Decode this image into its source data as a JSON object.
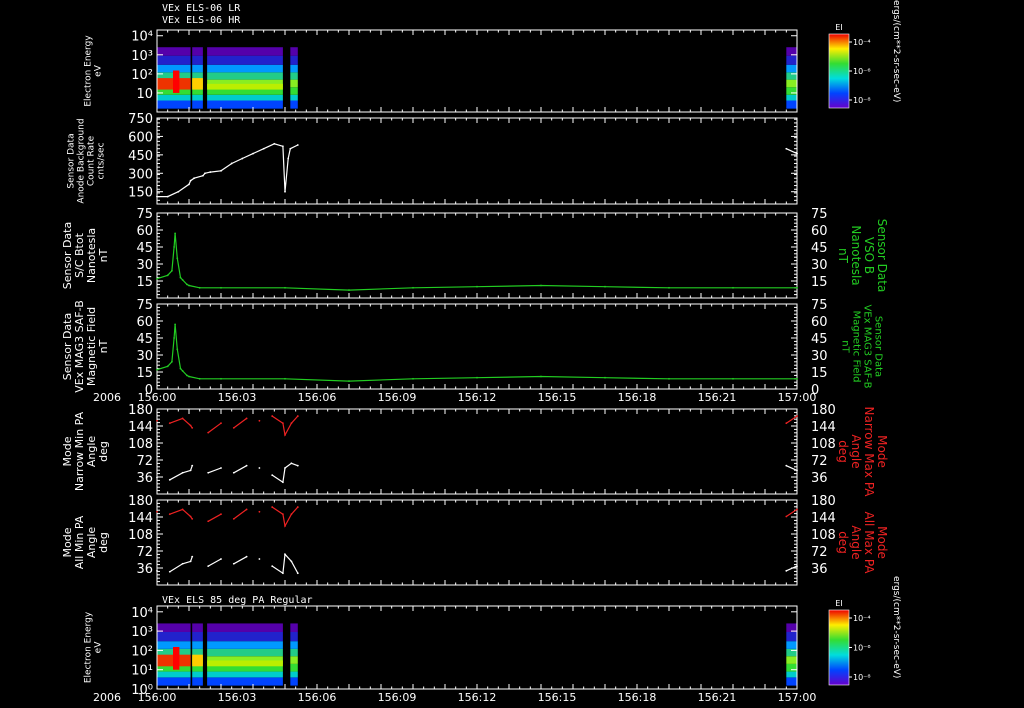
{
  "header": {
    "line1": "VEx ELS-06 LR",
    "line2": "VEx ELS-06 HR",
    "panel7_title": "VEx ELS 85 deg PA Regular"
  },
  "colors": {
    "background": "#000000",
    "white": "#ffffff",
    "green": "#22cc22",
    "red": "#ee2222"
  },
  "chart_data": [
    {
      "type": "heatmap",
      "name": "top-spectrogram",
      "ylabel": [
        "Electron Energy",
        "eV"
      ],
      "yscale": "log",
      "ylim": [
        1,
        20000
      ],
      "yticks": [
        {
          "v": 10,
          "label": "10"
        },
        {
          "v": 100,
          "label": "10²"
        },
        {
          "v": 1000,
          "label": "10³"
        },
        {
          "v": 10000,
          "label": "10⁴"
        }
      ],
      "colorbar": {
        "title": "EI",
        "units": "ergs/(cm**2-sr-sec-eV)",
        "ticks": [
          "10⁻⁴",
          "10⁻⁶",
          "10⁻⁸"
        ]
      },
      "coverage": [
        [
          156.0,
          156.0525
        ],
        [
          156.055,
          156.0717
        ],
        [
          156.0783,
          156.1967
        ],
        [
          156.2083,
          156.22
        ],
        [
          156.9833,
          157.0
        ]
      ],
      "x_range": [
        156.0,
        157.0
      ]
    },
    {
      "type": "line",
      "name": "anode-count",
      "ylabel": [
        "Sensor Data",
        "Anode Background",
        "Count Rate",
        "cnts/sec"
      ],
      "ylim": [
        50,
        750
      ],
      "yticks": [
        150,
        300,
        450,
        600,
        750
      ],
      "series": [
        {
          "color": "white",
          "points": [
            [
              156.0,
              110
            ],
            [
              156.0167,
              110
            ],
            [
              156.0333,
              150
            ],
            [
              156.05,
              210
            ],
            [
              156.0525,
              240
            ],
            [
              156.058,
              260
            ],
            [
              156.0717,
              280
            ],
            [
              156.075,
              300
            ],
            [
              156.0833,
              310
            ],
            [
              156.1,
              320
            ],
            [
              156.1167,
              380
            ],
            [
              156.1333,
              420
            ],
            [
              156.15,
              460
            ],
            [
              156.1667,
              500
            ],
            [
              156.1833,
              540
            ],
            [
              156.1967,
              520
            ],
            [
              156.2,
              150
            ],
            [
              156.205,
              420
            ],
            [
              156.2083,
              500
            ],
            [
              156.22,
              530
            ],
            [
              156.9833,
              500
            ],
            [
              157.0,
              460
            ]
          ]
        }
      ]
    },
    {
      "type": "line",
      "name": "sc-bmag",
      "ylabel": [
        "Sensor Data",
        "S/C Btot",
        "Nanotesla",
        "nT"
      ],
      "ylabel_right": [
        "Sensor Data",
        "VSO B",
        "Nanotesla",
        "nT"
      ],
      "ylim": [
        0,
        75
      ],
      "yticks": [
        15,
        30,
        45,
        60,
        75
      ],
      "series": [
        {
          "color": "green",
          "points": [
            [
              156.0,
              17
            ],
            [
              156.0167,
              20
            ],
            [
              156.0233,
              24
            ],
            [
              156.0267,
              45
            ],
            [
              156.0283,
              57
            ],
            [
              156.0317,
              35
            ],
            [
              156.0367,
              18
            ],
            [
              156.04,
              16
            ],
            [
              156.0467,
              12
            ],
            [
              156.05,
              11
            ],
            [
              156.0667,
              9
            ],
            [
              156.1,
              9
            ],
            [
              156.2,
              9
            ],
            [
              156.3,
              7
            ],
            [
              156.4,
              9
            ],
            [
              156.5,
              10
            ],
            [
              156.6,
              11
            ],
            [
              156.7,
              10
            ],
            [
              156.8,
              9
            ],
            [
              156.9,
              9
            ],
            [
              157.0,
              9
            ]
          ]
        }
      ]
    },
    {
      "type": "line",
      "name": "mag-saf-b",
      "ylabel": [
        "Sensor Data",
        "VEx MAG3 SAF-B",
        "Magnetic Field",
        "nT"
      ],
      "ylabel_right": [
        "Sensor Data",
        "VEx MAG3 SAF-B",
        "Magnetic Field",
        "nT"
      ],
      "ylim": [
        0,
        75
      ],
      "yticks": [
        0,
        15,
        30,
        45,
        60,
        75
      ],
      "x_label_prefix": "2006",
      "xticks": [
        "156:00",
        "156:03",
        "156:06",
        "156:09",
        "156:12",
        "156:15",
        "156:18",
        "156:21",
        "157:00"
      ],
      "series": [
        {
          "color": "green",
          "points": [
            [
              156.0,
              17
            ],
            [
              156.0167,
              20
            ],
            [
              156.0233,
              24
            ],
            [
              156.0267,
              45
            ],
            [
              156.0283,
              57
            ],
            [
              156.0317,
              35
            ],
            [
              156.0367,
              18
            ],
            [
              156.04,
              16
            ],
            [
              156.0467,
              12
            ],
            [
              156.05,
              11
            ],
            [
              156.0667,
              9
            ],
            [
              156.1,
              9
            ],
            [
              156.2,
              9
            ],
            [
              156.3,
              7
            ],
            [
              156.4,
              9
            ],
            [
              156.5,
              10
            ],
            [
              156.6,
              11
            ],
            [
              156.7,
              10
            ],
            [
              156.8,
              9
            ],
            [
              156.9,
              9
            ],
            [
              157.0,
              9
            ]
          ]
        }
      ]
    },
    {
      "type": "line",
      "name": "narrow-pa",
      "ylabel": [
        "Mode",
        "Narrow Min PA",
        "Angle",
        "deg"
      ],
      "ylabel_right": [
        "Mode",
        "Narrow Max PA",
        "Angle",
        "deg"
      ],
      "ylim": [
        0,
        180
      ],
      "yticks": [
        36,
        72,
        108,
        144,
        180
      ],
      "series": [
        {
          "color": "red",
          "points": [
            [
              156.0,
              155
            ],
            [
              156.02,
              150
            ],
            [
              156.04,
              160
            ],
            [
              156.0525,
              145
            ],
            [
              156.055,
              140
            ],
            [
              156.08,
              130
            ],
            [
              156.1,
              150
            ],
            [
              156.12,
              140
            ],
            [
              156.14,
              160
            ],
            [
              156.16,
              155
            ],
            [
              156.18,
              165
            ],
            [
              156.1967,
              150
            ],
            [
              156.2,
              125
            ],
            [
              156.21,
              150
            ],
            [
              156.22,
              165
            ],
            [
              156.9833,
              150
            ],
            [
              157.0,
              165
            ]
          ]
        },
        {
          "color": "white",
          "points": [
            [
              156.0,
              35
            ],
            [
              156.02,
              30
            ],
            [
              156.04,
              45
            ],
            [
              156.0525,
              50
            ],
            [
              156.055,
              60
            ],
            [
              156.08,
              45
            ],
            [
              156.1,
              55
            ],
            [
              156.12,
              45
            ],
            [
              156.14,
              60
            ],
            [
              156.16,
              55
            ],
            [
              156.18,
              40
            ],
            [
              156.1967,
              25
            ],
            [
              156.2,
              55
            ],
            [
              156.21,
              65
            ],
            [
              156.22,
              60
            ],
            [
              156.9833,
              60
            ],
            [
              157.0,
              50
            ]
          ]
        }
      ]
    },
    {
      "type": "line",
      "name": "all-pa",
      "ylabel": [
        "Mode",
        "All Min PA",
        "Angle",
        "deg"
      ],
      "ylabel_right": [
        "Mode",
        "All Max PA",
        "Angle",
        "deg"
      ],
      "ylim": [
        0,
        180
      ],
      "yticks": [
        36,
        72,
        108,
        144,
        180
      ],
      "series": [
        {
          "color": "red",
          "points": [
            [
              156.0,
              155
            ],
            [
              156.02,
              150
            ],
            [
              156.04,
              160
            ],
            [
              156.0525,
              145
            ],
            [
              156.055,
              140
            ],
            [
              156.08,
              135
            ],
            [
              156.1,
              150
            ],
            [
              156.12,
              140
            ],
            [
              156.14,
              160
            ],
            [
              156.16,
              155
            ],
            [
              156.18,
              165
            ],
            [
              156.1967,
              150
            ],
            [
              156.2,
              125
            ],
            [
              156.21,
              150
            ],
            [
              156.22,
              165
            ],
            [
              156.9833,
              145
            ],
            [
              157.0,
              160
            ]
          ]
        },
        {
          "color": "white",
          "points": [
            [
              156.0,
              30
            ],
            [
              156.02,
              28
            ],
            [
              156.04,
              45
            ],
            [
              156.0525,
              50
            ],
            [
              156.055,
              60
            ],
            [
              156.08,
              40
            ],
            [
              156.1,
              55
            ],
            [
              156.12,
              45
            ],
            [
              156.14,
              60
            ],
            [
              156.16,
              55
            ],
            [
              156.18,
              40
            ],
            [
              156.1967,
              25
            ],
            [
              156.2,
              65
            ],
            [
              156.21,
              50
            ],
            [
              156.22,
              25
            ],
            [
              156.9833,
              30
            ],
            [
              157.0,
              40
            ]
          ]
        }
      ]
    },
    {
      "type": "heatmap",
      "name": "bottom-spectrogram",
      "ylabel": [
        "Electron Energy",
        "eV"
      ],
      "yscale": "log",
      "ylim": [
        1,
        20000
      ],
      "yticks": [
        {
          "v": 1,
          "label": "10⁰"
        },
        {
          "v": 10,
          "label": "10¹"
        },
        {
          "v": 100,
          "label": "10²"
        },
        {
          "v": 1000,
          "label": "10³"
        },
        {
          "v": 10000,
          "label": "10⁴"
        }
      ],
      "x_label_prefix": "2006",
      "xticks": [
        "156:00",
        "156:03",
        "156:06",
        "156:09",
        "156:12",
        "156:15",
        "156:18",
        "156:21",
        "157:00"
      ],
      "colorbar": {
        "title": "EI",
        "units": "ergs/(cm**2-sr-sec-eV)",
        "ticks": [
          "10⁻⁴",
          "10⁻⁶",
          "10⁻⁸"
        ]
      },
      "coverage": [
        [
          156.0,
          156.0525
        ],
        [
          156.055,
          156.0717
        ],
        [
          156.0783,
          156.1967
        ],
        [
          156.2083,
          156.22
        ],
        [
          156.9833,
          157.0
        ]
      ],
      "x_range": [
        156.0,
        157.0
      ]
    }
  ]
}
